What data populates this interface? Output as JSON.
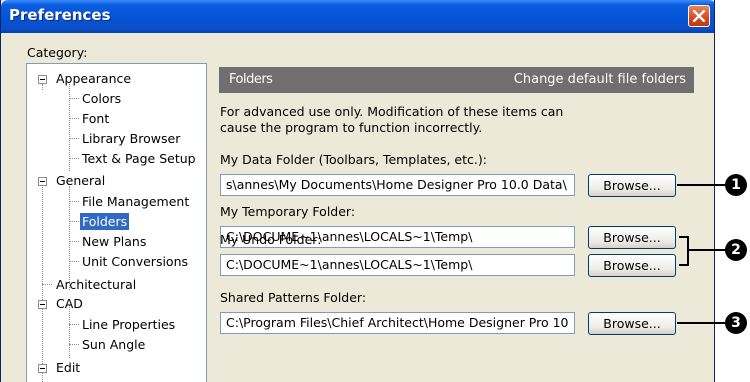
{
  "window": {
    "title": "Preferences"
  },
  "category": {
    "label": "Category:",
    "items": [
      {
        "label": "Appearance"
      },
      {
        "label": "Colors"
      },
      {
        "label": "Font"
      },
      {
        "label": "Library Browser"
      },
      {
        "label": "Text & Page Setup"
      },
      {
        "label": "General"
      },
      {
        "label": "File Management"
      },
      {
        "label": "Folders"
      },
      {
        "label": "New Plans"
      },
      {
        "label": "Unit Conversions"
      },
      {
        "label": "Architectural"
      },
      {
        "label": "CAD"
      },
      {
        "label": "Line Properties"
      },
      {
        "label": "Sun Angle"
      },
      {
        "label": "Edit"
      }
    ],
    "selected": "Folders"
  },
  "panel": {
    "title": "Folders",
    "subtitle": "Change default file folders",
    "warning_line1": "For advanced use only. Modification of these items can",
    "warning_line2": "cause the program to function incorrectly."
  },
  "fields": [
    {
      "label": "My Data Folder (Toolbars, Templates, etc.):",
      "value": "s\\annes\\My Documents\\Home Designer Pro 10.0 Data\\",
      "button": "Browse..."
    },
    {
      "label": "My Temporary Folder:",
      "value": "C:\\DOCUME~1\\annes\\LOCALS~1\\Temp\\",
      "button": "Browse..."
    },
    {
      "label": "My Undo Folder:",
      "value": "C:\\DOCUME~1\\annes\\LOCALS~1\\Temp\\",
      "button": "Browse..."
    },
    {
      "label": "Shared Patterns Folder:",
      "value": "C:\\Program Files\\Chief Architect\\Home Designer Pro 10",
      "button": "Browse..."
    }
  ],
  "callouts": [
    "1",
    "2",
    "3"
  ],
  "colors": {
    "title_bar": "#0553d6",
    "close_button": "#d8491f",
    "header_bar": "#6f6f6f",
    "selection": "#316ac5",
    "dialog_bg": "#ece9d8"
  }
}
